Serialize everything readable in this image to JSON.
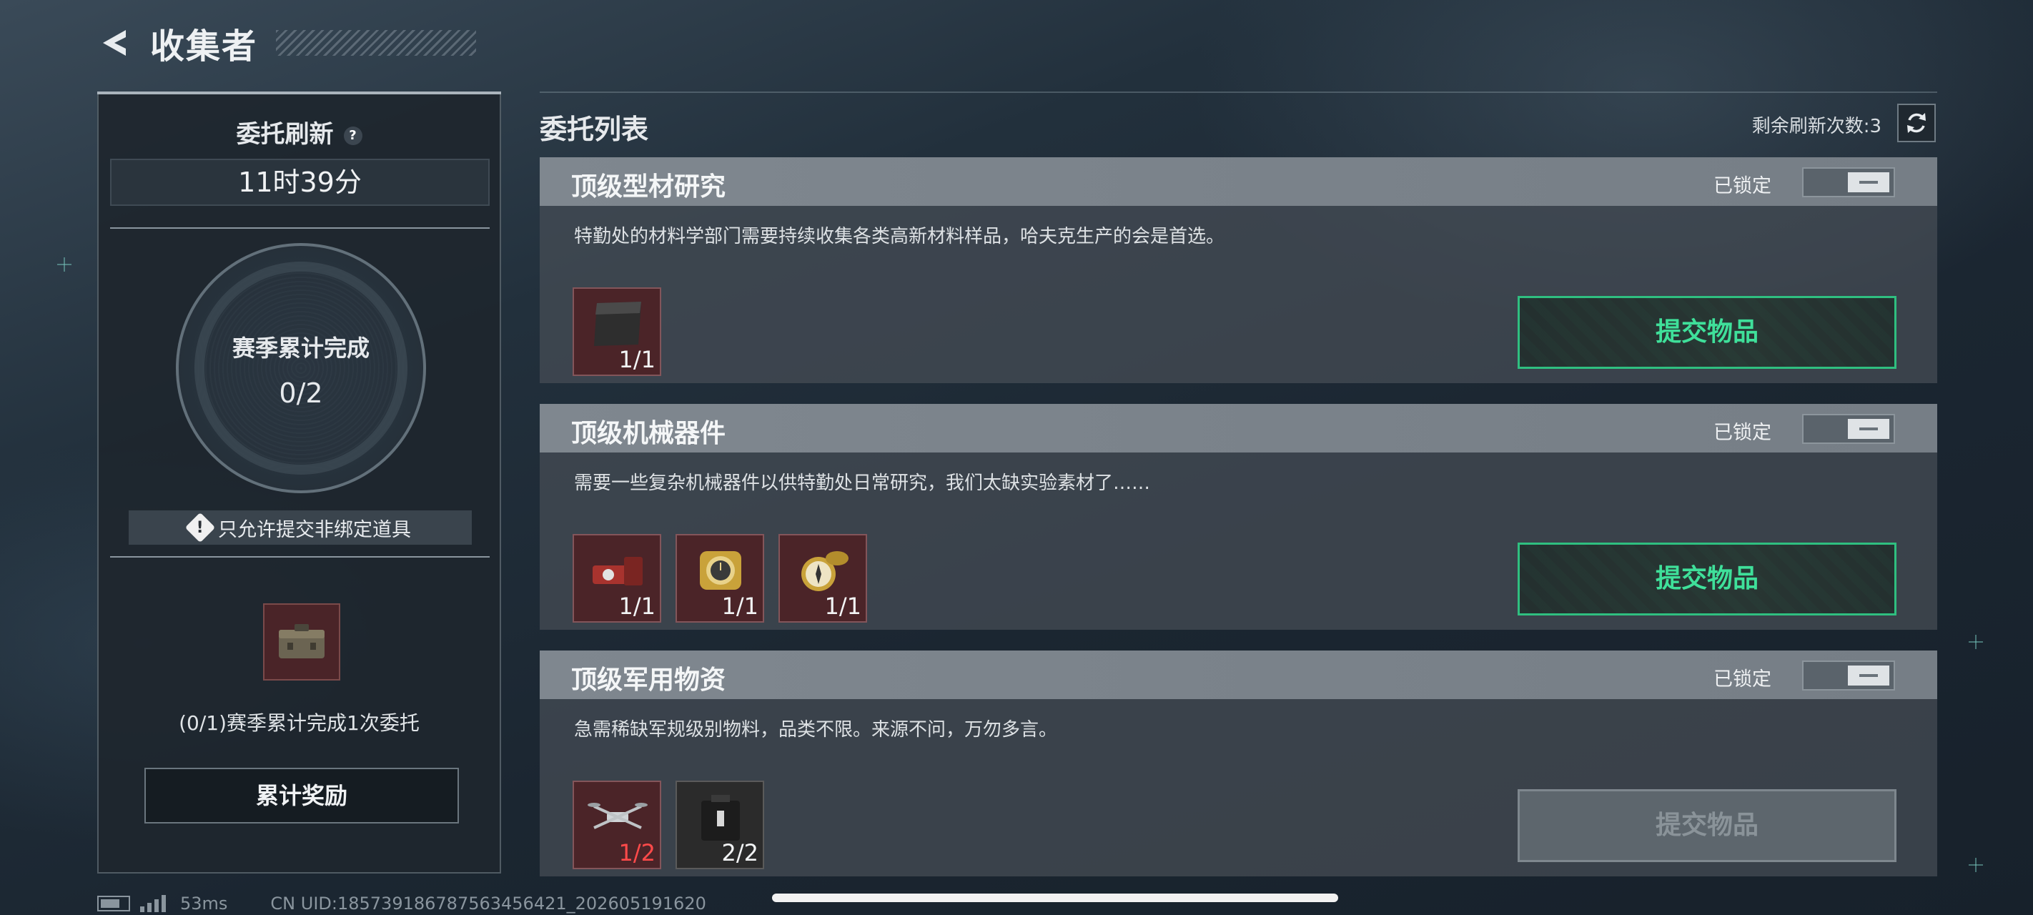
{
  "header": {
    "title": "收集者"
  },
  "left_panel": {
    "refresh_title": "委托刷新",
    "help_symbol": "?",
    "timer": "11时39分",
    "season_label": "赛季累计完成",
    "season_count": "0/2",
    "notice": "只允许提交非绑定道具",
    "reward_desc": "(0/1)赛季累计完成1次委托",
    "reward_button": "累计奖励"
  },
  "list": {
    "title": "委托列表",
    "refresh_count": "剩余刷新次数:3"
  },
  "tasks": [
    {
      "name": "顶级型材研究",
      "lock_label": "已锁定",
      "desc": "特勤处的材料学部门需要持续收集各类高新材料样品，哈夫克生产的会是首选。",
      "items": [
        {
          "icon": "material-plate-icon",
          "qty": "1/1"
        }
      ],
      "submit": "提交物品",
      "submit_enabled": true
    },
    {
      "name": "顶级机械器件",
      "lock_label": "已锁定",
      "desc": "需要一些复杂机械器件以供特勤处日常研究，我们太缺实验素材了……",
      "items": [
        {
          "icon": "mechanical-part-icon",
          "qty": "1/1"
        },
        {
          "icon": "gold-watch-icon",
          "qty": "1/1"
        },
        {
          "icon": "pocket-compass-icon",
          "qty": "1/1"
        }
      ],
      "submit": "提交物品",
      "submit_enabled": true
    },
    {
      "name": "顶级军用物资",
      "lock_label": "已锁定",
      "desc": "急需稀缺军规级别物料，品类不限。来源不问，万勿多言。",
      "items": [
        {
          "icon": "drone-icon",
          "qty": "1/2"
        },
        {
          "icon": "military-case-icon",
          "qty": "2/2"
        }
      ],
      "submit": "提交物品",
      "submit_enabled": false
    }
  ],
  "status_bar": {
    "ping": "53ms",
    "uid": "CN UID:18573918678756345642​1_202605191620"
  },
  "colors": {
    "accent_green": "#3fe09a",
    "item_bg": "#4b2428",
    "warning_red": "#ff4a4a"
  }
}
